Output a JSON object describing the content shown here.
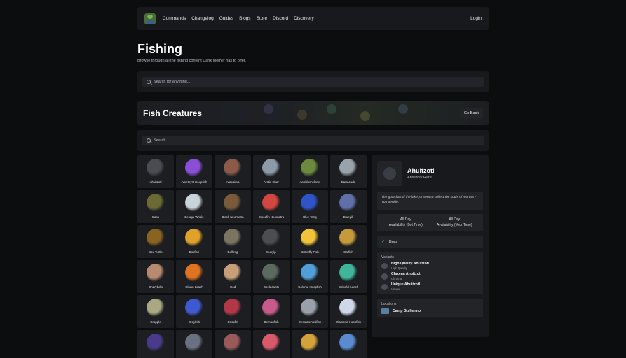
{
  "nav": {
    "links": [
      "Commands",
      "Changelog",
      "Guides",
      "Blogs",
      "Store",
      "Discord",
      "Discovery"
    ],
    "login": "Login"
  },
  "page": {
    "title": "Fishing",
    "subtitle": "Browse through all the fishing content Dank Memer has to offer.",
    "global_search_placeholder": "Search for anything..."
  },
  "banner": {
    "title": "Fish Creatures",
    "back_label": "Go Back"
  },
  "filter": {
    "placeholder": "Search..."
  },
  "creatures": [
    {
      "name": "Ahuitzotl",
      "color": "#4a4c52"
    },
    {
      "name": "Amethyst Hoopfish",
      "color": "#8a4fd6"
    },
    {
      "name": "Arapaima",
      "color": "#8c5a48"
    },
    {
      "name": "Arctic Char",
      "color": "#8d9aa8"
    },
    {
      "name": "Aspidochelone",
      "color": "#6b8a3e"
    },
    {
      "name": "Barracuda",
      "color": "#9aa2ac"
    },
    {
      "name": "Bass",
      "color": "#6b6a35"
    },
    {
      "name": "Beluga Whale",
      "color": "#c9d3da"
    },
    {
      "name": "Black Neometra",
      "color": "#7a5a3a"
    },
    {
      "name": "Bloodfin Neometra",
      "color": "#d2473f"
    },
    {
      "name": "Blue Tang",
      "color": "#2f54c8"
    },
    {
      "name": "Bluegill",
      "color": "#5f6fa8"
    },
    {
      "name": "Box Turtle",
      "color": "#8a6320"
    },
    {
      "name": "Boxfish",
      "color": "#e0a12a"
    },
    {
      "name": "Bullfrog",
      "color": "#7a7460"
    },
    {
      "name": "Bunyip",
      "color": "#4b4d4f"
    },
    {
      "name": "Butterfly Fish",
      "color": "#f2c23a"
    },
    {
      "name": "Catfish",
      "color": "#c49a3a"
    },
    {
      "name": "Charybdis",
      "color": "#b88a70"
    },
    {
      "name": "Clown Loach",
      "color": "#e0731f"
    },
    {
      "name": "Cod",
      "color": "#c7a07a"
    },
    {
      "name": "Coelacanth",
      "color": "#5a6a5c"
    },
    {
      "name": "Colorful Hoopfish",
      "color": "#4fa0d8"
    },
    {
      "name": "Colorful Leech",
      "color": "#3fb59a"
    },
    {
      "name": "Crapple",
      "color": "#a8a882"
    },
    {
      "name": "Crayfish",
      "color": "#3f5ad0"
    },
    {
      "name": "Crispfin",
      "color": "#b23848"
    },
    {
      "name": "Demonfish",
      "color": "#c65a8a"
    },
    {
      "name": "Desolate Yetifish",
      "color": "#9aa0aa"
    },
    {
      "name": "Diamond Hoopfish",
      "color": "#cfd8e8"
    },
    {
      "name": "",
      "color": "#4a3a8a"
    },
    {
      "name": "",
      "color": "#6a7282"
    },
    {
      "name": "",
      "color": "#9a5a5a"
    },
    {
      "name": "",
      "color": "#d85a6a"
    },
    {
      "name": "",
      "color": "#d4a23a"
    },
    {
      "name": "",
      "color": "#5a8ad0"
    }
  ],
  "detail": {
    "name": "Ahuitzotl",
    "rarity": "Absurdly Rare",
    "description": "The guardian of the lake, or sent to collect the souls of mortals? You decide.",
    "availability": [
      {
        "value": "All Day",
        "label": "Availability (Bot Time)"
      },
      {
        "value": "All Day",
        "label": "Availability (Your Time)"
      }
    ],
    "tag": "Boss",
    "variants_label": "Variants",
    "variants": [
      {
        "name": "High Quality Ahuitzotl",
        "type": "High Quality"
      },
      {
        "name": "Chroma Ahuitzotl",
        "type": "Chroma"
      },
      {
        "name": "Unique Ahuitzotl",
        "type": "Unique"
      }
    ],
    "locations_label": "Locations",
    "locations": [
      "Camp Guillermo"
    ]
  }
}
